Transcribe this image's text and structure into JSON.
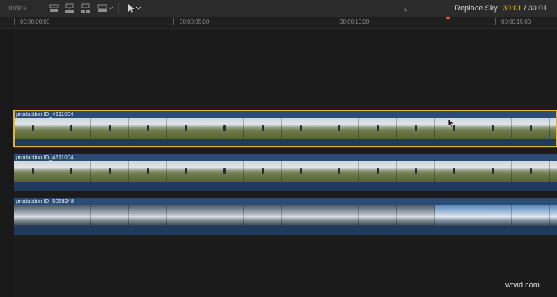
{
  "toolbar": {
    "index_label": "Index",
    "back_glyph": "‹",
    "project_title": "Replace Sky",
    "timecode_current": "30:01",
    "timecode_separator": "/",
    "timecode_duration": "30:01",
    "icons": [
      "clip-appearance-icon",
      "connect-clip-icon",
      "insert-clip-icon",
      "overwrite-clip-icon",
      "select-tool-icon"
    ]
  },
  "ruler": {
    "labels": [
      "00:00:00:00",
      "00:00:05:00",
      "00:00:10:00",
      "00:00:15:00"
    ]
  },
  "clips": [
    {
      "name": "production ID_4511004",
      "kind": "field",
      "selected": true
    },
    {
      "name": "production ID_4511004",
      "kind": "field",
      "selected": false
    },
    {
      "name": "production ID_5058248",
      "kind": "sky",
      "selected": false
    }
  ],
  "watermark": "wtvid.com",
  "colors": {
    "accent_playhead": "#e35a3c",
    "selection_outline": "#e2b62a",
    "clip_blue": "#2b4c75",
    "timecode_yellow": "#e6b619"
  }
}
